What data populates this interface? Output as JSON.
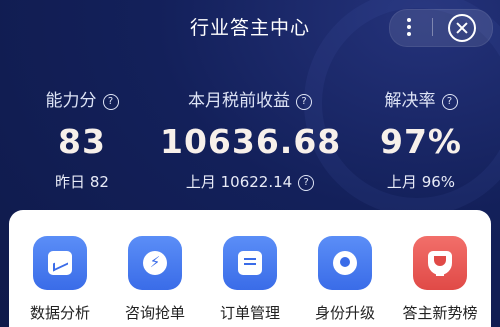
{
  "header": {
    "title": "行业答主中心"
  },
  "stats": [
    {
      "label": "能力分",
      "value": "83",
      "sub_label": "昨日",
      "sub_value": "82"
    },
    {
      "label": "本月税前收益",
      "value": "10636.68",
      "sub_label": "上月",
      "sub_value": "10622.14"
    },
    {
      "label": "解决率",
      "value": "97%",
      "sub_label": "上月",
      "sub_value": "96%"
    }
  ],
  "quick_actions": [
    {
      "label": "数据分析",
      "icon": "chart-icon",
      "color": "#3a6ce8"
    },
    {
      "label": "咨询抢单",
      "icon": "bolt-icon",
      "color": "#3a6ce8"
    },
    {
      "label": "订单管理",
      "icon": "document-icon",
      "color": "#3a6ce8"
    },
    {
      "label": "身份升级",
      "icon": "person-icon",
      "color": "#3a6ce8"
    },
    {
      "label": "答主新势榜",
      "icon": "trophy-icon",
      "color": "#e04a47"
    }
  ],
  "colors": {
    "background": "#0f1a4a",
    "accent_blue": "#3a6ce8",
    "accent_red": "#e04a47"
  }
}
